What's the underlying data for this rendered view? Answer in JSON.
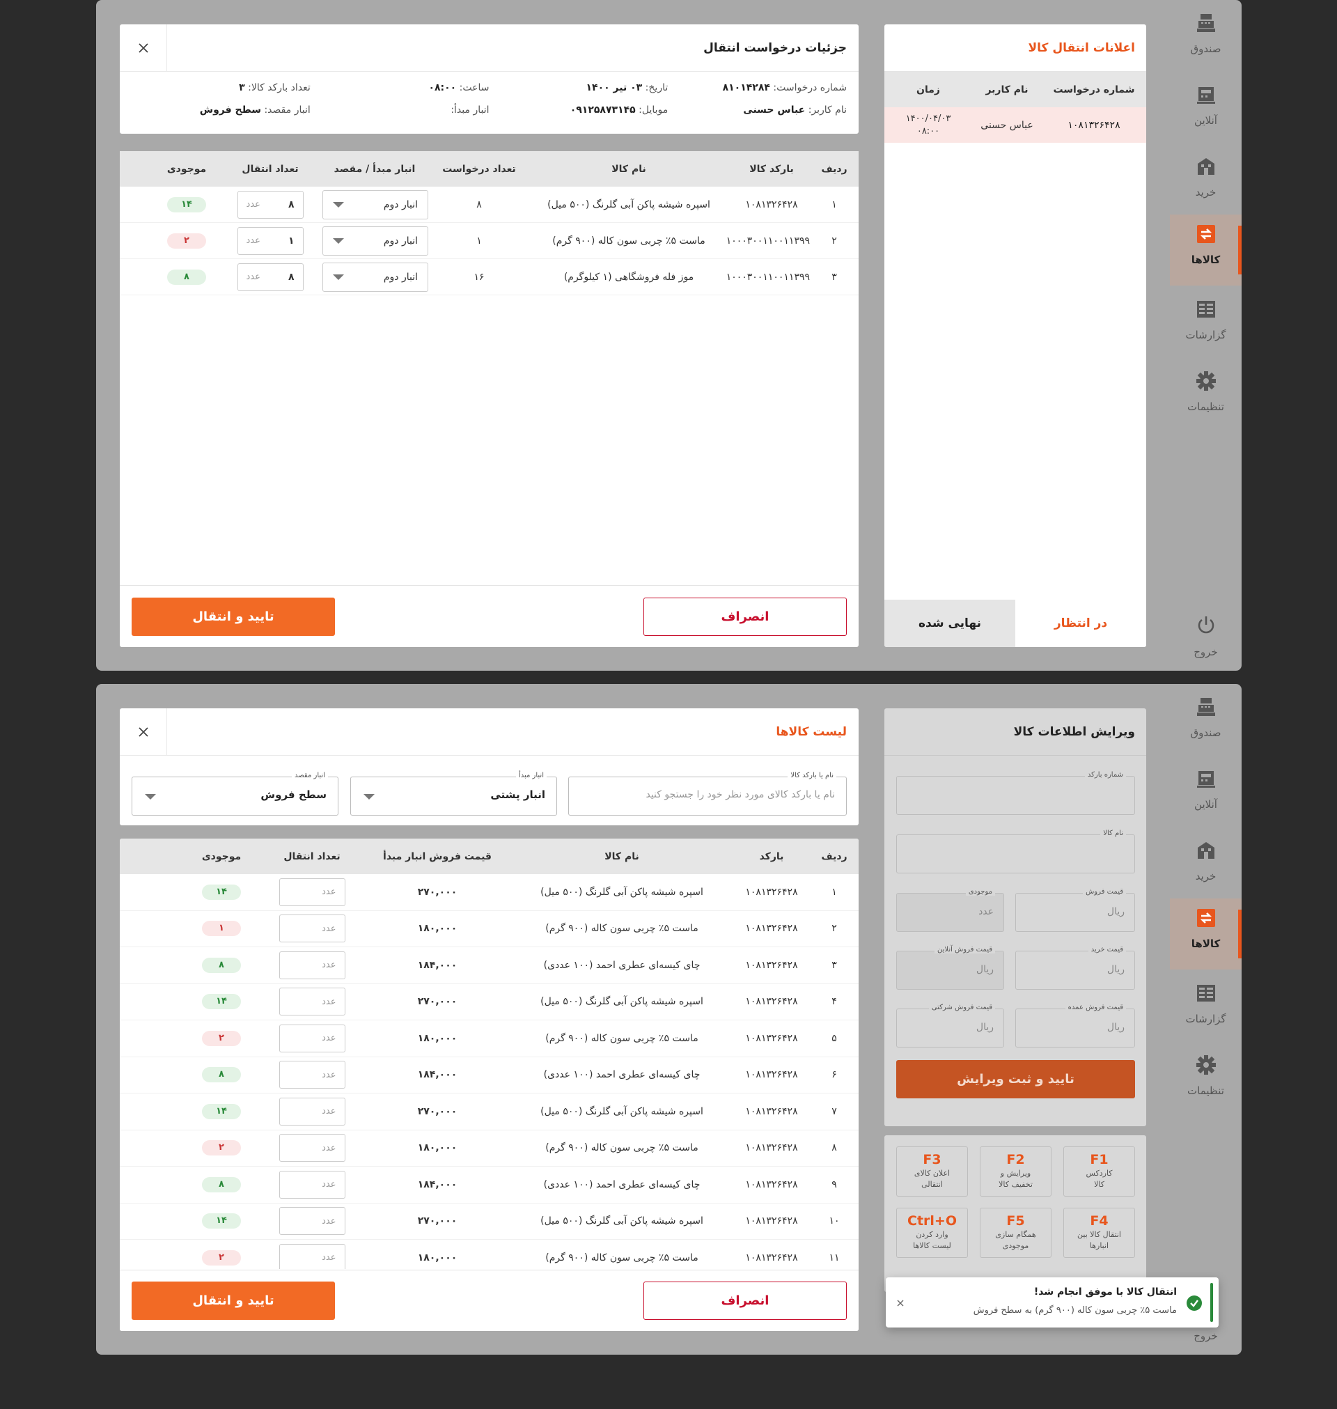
{
  "nav": {
    "items": [
      {
        "label": "صندوق",
        "icon": "cash-register-icon"
      },
      {
        "label": "آنلاین",
        "icon": "online-register-icon"
      },
      {
        "label": "خرید",
        "icon": "store-icon"
      },
      {
        "label": "کالاها",
        "icon": "transfer-icon"
      },
      {
        "label": "گزارشات",
        "icon": "report-icon"
      },
      {
        "label": "تنظیمات",
        "icon": "gear-icon"
      }
    ],
    "logout": "خروج",
    "active": "کالاها"
  },
  "notifications": {
    "title": "اعلانات انتقال کالا",
    "columns": [
      "شماره درخواست",
      "نام کاربر",
      "زمان"
    ],
    "rows": [
      {
        "req": "۱۰۸۱۳۲۶۴۲۸",
        "user": "عباس حسنی",
        "date": "۱۴۰۰/۰۴/۰۳",
        "time": "۰۸:۰۰"
      }
    ],
    "tab_pending": "در انتظار",
    "tab_final": "نهایی شده"
  },
  "details": {
    "title": "جزئیات درخواست انتقال",
    "info": [
      {
        "k": "شماره درخواست:",
        "v": "۸۱۰۱۴۲۸۴"
      },
      {
        "k": "تاریخ:",
        "v": "۰۳ تیر ۱۴۰۰"
      },
      {
        "k": "ساعت:",
        "v": "۰۸:۰۰"
      },
      {
        "k": "تعداد بارکد کالا:",
        "v": "۳"
      },
      {
        "k": "نام کاربر:",
        "v": "عباس حسنی"
      },
      {
        "k": "موبایل:",
        "v": "۰۹۱۲۵۸۷۳۱۴۵"
      },
      {
        "k": "انبار مبدأ:",
        "v": ""
      },
      {
        "k": "انبار مقصد:",
        "v": "سطح فروش"
      }
    ],
    "columns": [
      "ردیف",
      "بارکد کالا",
      "نام کالا",
      "تعداد درخواست",
      "انبار مبدأ / مقصد",
      "تعداد انتقال",
      "موجودی"
    ],
    "rows": [
      {
        "n": "۱",
        "barcode": "۱۰۸۱۳۲۶۴۲۸",
        "name": "اسپره شیشه پاکن آبی گلرنگ (۵۰۰ میل)",
        "req": "۸",
        "warehouse": "انبار دوم",
        "qty": "۸",
        "stock": "۱۴",
        "status": "g"
      },
      {
        "n": "۲",
        "barcode": "۱۰۰۰۳۰۰۱۱۰۰۱۱۳۹۹",
        "name": "ماست ۵٪ چربی سون کاله (۹۰۰ گرم)",
        "req": "۱",
        "warehouse": "انبار دوم",
        "qty": "۱",
        "stock": "۲",
        "status": "r"
      },
      {
        "n": "۳",
        "barcode": "۱۰۰۰۳۰۰۱۱۰۰۱۱۳۹۹",
        "name": "موز فله فروشگاهی (۱ کیلوگرم)",
        "req": "۱۶",
        "warehouse": "انبار دوم",
        "qty": "۸",
        "stock": "۸",
        "status": "g"
      }
    ],
    "unit": "عدد",
    "cancel": "انصراف",
    "confirm": "تایید و انتقال"
  },
  "edit": {
    "title": "ویرایش اطلاعات کالا",
    "barcode_label": "شماره بارکد",
    "name_label": "نام کالا",
    "sale_price_label": "قیمت فروش",
    "stock_label": "موجودی",
    "buy_price_label": "قیمت خرید",
    "online_price_label": "قیمت فروش آنلاین",
    "wholesale_label": "قیمت فروش عمده",
    "corporate_label": "قیمت فروش شرکتی",
    "rial": "ریال",
    "unit": "عدد",
    "submit": "تایید و ثبت ویرایش"
  },
  "shortcuts": [
    {
      "key": "F1",
      "l1": "کاردکس",
      "l2": "کالا"
    },
    {
      "key": "F2",
      "l1": "ویرایش و",
      "l2": "تخفیف کالا"
    },
    {
      "key": "F3",
      "l1": "اعلان کالای",
      "l2": "انتقالی"
    },
    {
      "key": "F4",
      "l1": "انتقال کالا بین",
      "l2": "انبارها"
    },
    {
      "key": "F5",
      "l1": "همگام سازی",
      "l2": "موجودی"
    },
    {
      "key": "Ctrl+O",
      "l1": "وارد کردن",
      "l2": "لیست کالاها"
    }
  ],
  "products": {
    "title": "لیست کالاها",
    "search_label": "نام یا بارکد کالا",
    "search_placeholder": "نام یا بارکد کالای مورد نظر خود را جستجو کنید",
    "source_label": "انبار مبدأ",
    "source_value": "انبار پشتی",
    "dest_label": "انبار مقصد",
    "dest_value": "سطح فروش",
    "columns": [
      "ردیف",
      "بارکد",
      "نام کالا",
      "قیمت فروش انبار مبدأ",
      "تعداد انتقال",
      "موجودی"
    ],
    "rows": [
      {
        "n": "۱",
        "barcode": "۱۰۸۱۳۲۶۴۲۸",
        "name": "اسپره شیشه پاکن آبی گلرنگ (۵۰۰ میل)",
        "price": "۲۷۰,۰۰۰",
        "stock": "۱۴",
        "status": "g"
      },
      {
        "n": "۲",
        "barcode": "۱۰۸۱۳۲۶۴۲۸",
        "name": "ماست ۵٪ چربی سون کاله (۹۰۰ گرم)",
        "price": "۱۸۰,۰۰۰",
        "stock": "۱",
        "status": "r"
      },
      {
        "n": "۳",
        "barcode": "۱۰۸۱۳۲۶۴۲۸",
        "name": "چای کیسه‌ای عطری احمد (۱۰۰ عددی)",
        "price": "۱۸۴,۰۰۰",
        "stock": "۸",
        "status": "g"
      },
      {
        "n": "۴",
        "barcode": "۱۰۸۱۳۲۶۴۲۸",
        "name": "اسپره شیشه پاکن آبی گلرنگ (۵۰۰ میل)",
        "price": "۲۷۰,۰۰۰",
        "stock": "۱۴",
        "status": "g"
      },
      {
        "n": "۵",
        "barcode": "۱۰۸۱۳۲۶۴۲۸",
        "name": "ماست ۵٪ چربی سون کاله (۹۰۰ گرم)",
        "price": "۱۸۰,۰۰۰",
        "stock": "۲",
        "status": "r"
      },
      {
        "n": "۶",
        "barcode": "۱۰۸۱۳۲۶۴۲۸",
        "name": "چای کیسه‌ای عطری احمد (۱۰۰ عددی)",
        "price": "۱۸۴,۰۰۰",
        "stock": "۸",
        "status": "g"
      },
      {
        "n": "۷",
        "barcode": "۱۰۸۱۳۲۶۴۲۸",
        "name": "اسپره شیشه پاکن آبی گلرنگ (۵۰۰ میل)",
        "price": "۲۷۰,۰۰۰",
        "stock": "۱۴",
        "status": "g"
      },
      {
        "n": "۸",
        "barcode": "۱۰۸۱۳۲۶۴۲۸",
        "name": "ماست ۵٪ چربی سون کاله (۹۰۰ گرم)",
        "price": "۱۸۰,۰۰۰",
        "stock": "۲",
        "status": "r"
      },
      {
        "n": "۹",
        "barcode": "۱۰۸۱۳۲۶۴۲۸",
        "name": "چای کیسه‌ای عطری احمد (۱۰۰ عددی)",
        "price": "۱۸۴,۰۰۰",
        "stock": "۸",
        "status": "g"
      },
      {
        "n": "۱۰",
        "barcode": "۱۰۸۱۳۲۶۴۲۸",
        "name": "اسپره شیشه پاکن آبی گلرنگ (۵۰۰ میل)",
        "price": "۲۷۰,۰۰۰",
        "stock": "۱۴",
        "status": "g"
      },
      {
        "n": "۱۱",
        "barcode": "۱۰۸۱۳۲۶۴۲۸",
        "name": "ماست ۵٪ چربی سون کاله (۹۰۰ گرم)",
        "price": "۱۸۰,۰۰۰",
        "stock": "۲",
        "status": "r"
      }
    ],
    "unit": "عدد",
    "cancel": "انصراف",
    "confirm": "تایید و انتقال"
  },
  "toast": {
    "title": "انتقال کالا با موفق انجام شد!",
    "message": "ماست ۵٪ چربی سون کاله (۹۰۰ گرم) به سطح فروش"
  },
  "colors": {
    "accent": "#f26a25",
    "danger": "#c8102e",
    "success": "#2a8a3a"
  }
}
